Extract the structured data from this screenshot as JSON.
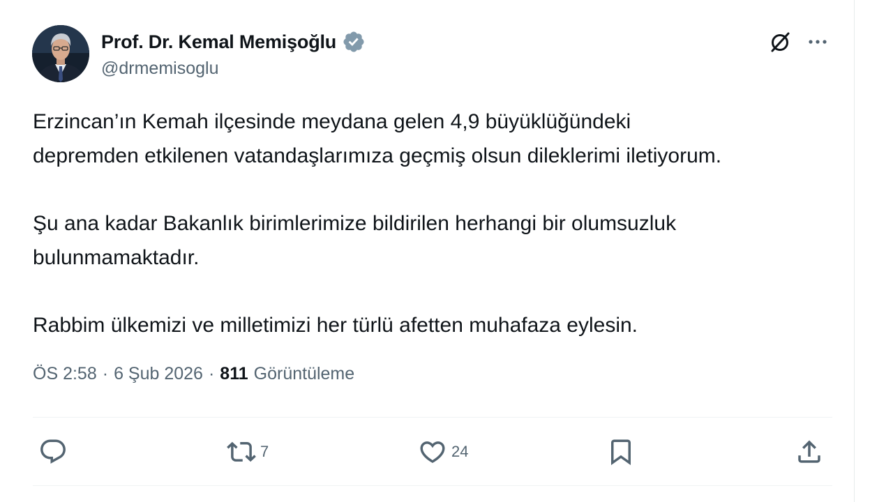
{
  "author": {
    "name": "Prof. Dr. Kemal Memişoğlu",
    "handle": "@drmemisoglu",
    "verified_icon": "verified-badge-icon",
    "verified_color": "#829aab"
  },
  "header_actions": {
    "grok_icon": "grok-icon",
    "more_icon": "more-dots-icon"
  },
  "tweet": {
    "paragraphs": [
      "Erzincan’ın Kemah ilçesinde meydana gelen 4,9 büyüklüğündeki\ndepremden etkilenen vatandaşlarımıza geçmiş olsun dileklerimi iletiyorum.",
      "Şu ana kadar Bakanlık birimlerimize bildirilen herhangi bir olumsuzluk\nbulunmamaktadır.",
      "Rabbim ülkemizi ve milletimizi her türlü afetten muhafaza eylesin."
    ]
  },
  "meta": {
    "time": "ÖS 2:58",
    "separator": "·",
    "date": "6 Şub 2026",
    "views_count": "811",
    "views_label": "Görüntüleme"
  },
  "actions": {
    "reply_icon": "reply-icon",
    "repost_icon": "repost-icon",
    "repost_count": "7",
    "like_icon": "heart-icon",
    "like_count": "24",
    "bookmark_icon": "bookmark-icon",
    "share_icon": "share-icon"
  },
  "colors": {
    "text_primary": "#0f1419",
    "text_secondary": "#536471",
    "divider": "#eff3f4"
  }
}
